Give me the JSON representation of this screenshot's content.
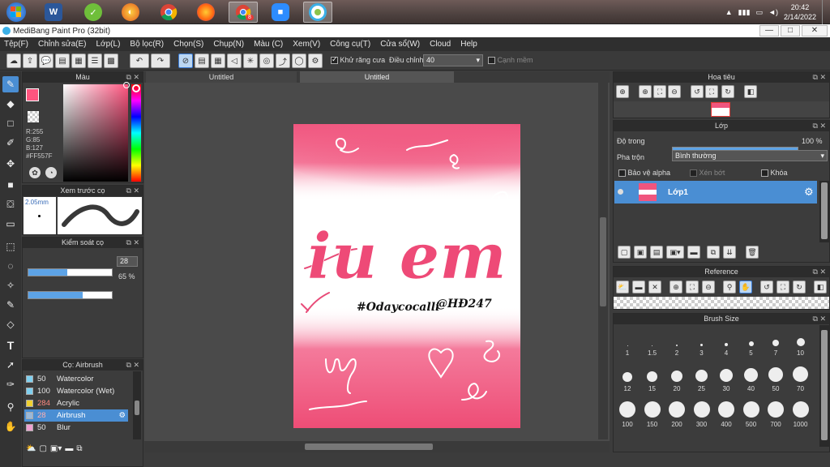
{
  "taskbar": {
    "time": "20:42",
    "date": "2/14/2022",
    "badge": "8"
  },
  "window": {
    "title": "MediBang Paint Pro (32bit)",
    "min": "—",
    "max": "□",
    "close": "✕"
  },
  "menu": [
    "Tệp(F)",
    "Chỉnh sửa(E)",
    "Lớp(L)",
    "Bộ lọc(R)",
    "Chọn(S)",
    "Chụp(N)",
    "Màu (C)",
    "Xem(V)",
    "Công cụ(T)",
    "Cửa sổ(W)",
    "Cloud",
    "Help"
  ],
  "toolbar": {
    "antialias": "Khử răng cưa",
    "correction_label": "Điều chỉnh",
    "correction_value": "40",
    "edge": "Cạnh mềm"
  },
  "color_panel": {
    "title": "Màu",
    "r": "R:255",
    "g": "G:85",
    "b": "B:127",
    "hex": "#FF557F",
    "main_color": "#FF557F"
  },
  "brush_preview": {
    "title": "Xem trước cọ",
    "size": "2.05mm"
  },
  "brush_control": {
    "title": "Kiểm soát cọ",
    "size_value": "28",
    "size_fill": 0.47,
    "opacity_value": "65 %",
    "opacity_fill": 0.65
  },
  "brush_list": {
    "title": "Cọ: Airbrush",
    "items": [
      {
        "size": "50",
        "name": "Watercolor",
        "color": "#7fd0f0"
      },
      {
        "size": "100",
        "name": "Watercolor (Wet)",
        "color": "#7fd0f0"
      },
      {
        "size": "284",
        "name": "Acrylic",
        "color": "#f0d030"
      },
      {
        "size": "28",
        "name": "Airbrush",
        "color": "#9ab8d8"
      },
      {
        "size": "50",
        "name": "Blur",
        "color": "#f0a0d0"
      }
    ]
  },
  "tabs": [
    "Untitled",
    "Untitled"
  ],
  "artwork": {
    "main_text": "iu em",
    "tag1": "#Odaycocalli",
    "tag2": "@HĐ247"
  },
  "navigator": {
    "title": "Hoa tiêu"
  },
  "layer_panel": {
    "title": "Lớp",
    "opacity_label": "Độ trong",
    "opacity_value": "100 %",
    "blend_label": "Pha trộn",
    "blend_value": "Bình thường",
    "protect_alpha": "Bảo vệ alpha",
    "clip": "Xén bớt",
    "lock": "Khóa",
    "layer_name": "Lớp1"
  },
  "reference": {
    "title": "Reference"
  },
  "brush_size": {
    "title": "Brush Size",
    "sizes": [
      "1",
      "1.5",
      "2",
      "3",
      "4",
      "5",
      "7",
      "10",
      "12",
      "15",
      "20",
      "25",
      "30",
      "40",
      "50",
      "70",
      "100",
      "150",
      "200",
      "300",
      "400",
      "500",
      "700",
      "1000"
    ]
  }
}
